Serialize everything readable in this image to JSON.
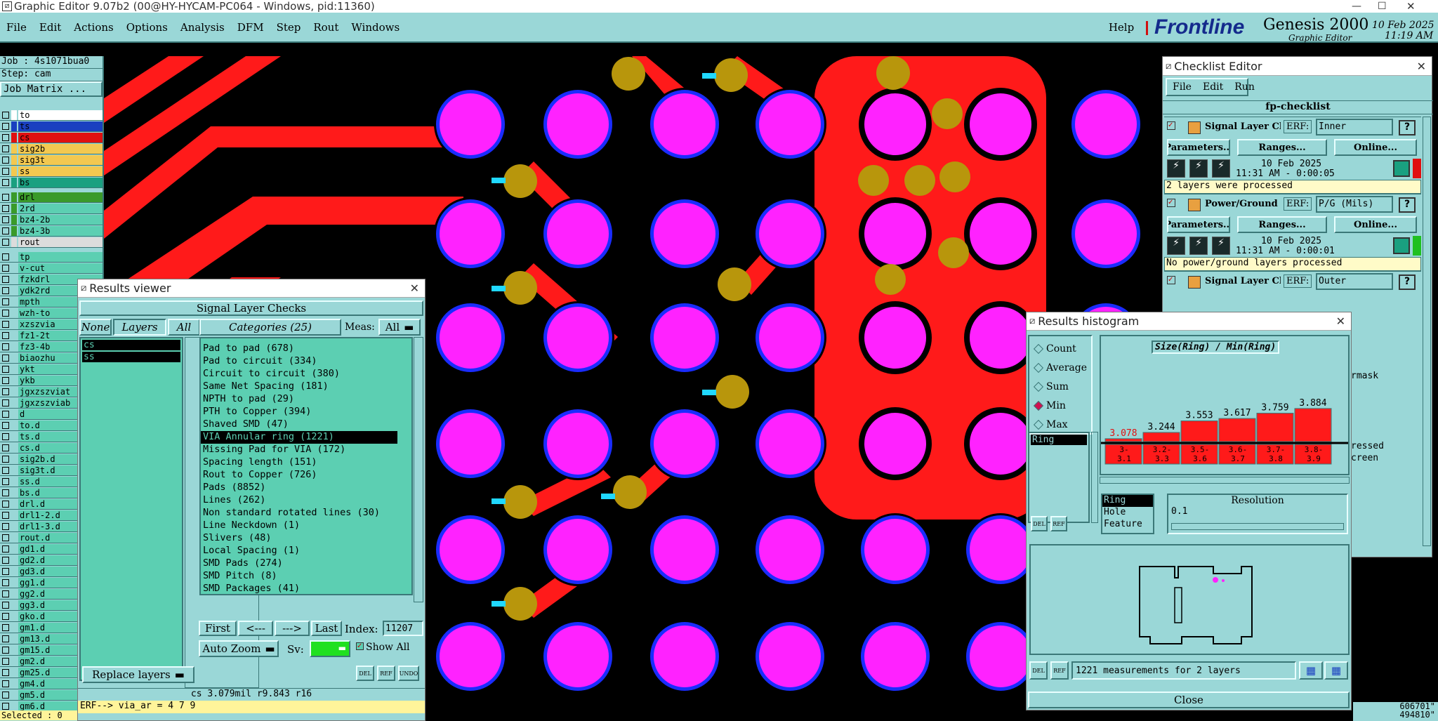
{
  "window": {
    "title": "Graphic Editor 9.07b2 (00@HY-HYCAM-PC064 - Windows, pid:11360)",
    "min": "—",
    "max": "☐",
    "close": "✕"
  },
  "menu": {
    "items": [
      "File",
      "Edit",
      "Actions",
      "Options",
      "Analysis",
      "DFM",
      "Step",
      "Rout",
      "Windows"
    ],
    "help": "Help"
  },
  "brand": {
    "logo": "Frontline",
    "product": "Genesis 2000",
    "subtitle": "Graphic Editor",
    "date": "10 Feb 2025",
    "time": "11:19 AM"
  },
  "left": {
    "job": "Job : 4s1071bua0",
    "step": "Step: cam",
    "matrix_button": "Job Matrix ...",
    "layers_a": [
      "to",
      "ts",
      "cs",
      "sig2b",
      "sig3t",
      "ss",
      "bs"
    ],
    "layers_b": [
      "drl",
      "2rd",
      "bz4-2b",
      "bz4-3b",
      "rout"
    ],
    "layers_c": [
      "tp",
      "v-cut",
      "fzkdrl",
      "ydk2rd",
      "mpth",
      "wzh-to",
      "xzszvia",
      "fz1-2t",
      "fz3-4b",
      "biaozhu",
      "ykt",
      "ykb",
      "jgxzszviat",
      "jgxzszviab",
      "d",
      "to.d",
      "ts.d",
      "cs.d",
      "sig2b.d",
      "sig3t.d",
      "ss.d",
      "bs.d",
      "drl.d",
      "drl1-2.d",
      "drl1-3.d",
      "rout.d",
      "gd1.d",
      "gd2.d",
      "gd3.d",
      "gg1.d",
      "gg2.d",
      "gg3.d",
      "gko.d",
      "gm1.d",
      "gm13.d",
      "gm15.d",
      "gm2.d",
      "gm25.d",
      "gm4.d",
      "gm5.d",
      "gm6.d"
    ],
    "selected": "Selected : 0"
  },
  "results_viewer": {
    "title": "Results viewer",
    "close": "✕",
    "header": "Signal Layer Checks",
    "none": "None",
    "layers": "Layers",
    "all": "All",
    "layer_list": [
      "cs",
      "ss"
    ],
    "categories_button": "Categories (25)",
    "meas_label": "Meas:",
    "meas_value": "All",
    "categories": [
      "Pad to pad (678)",
      "Pad to circuit (334)",
      "Circuit to circuit (380)",
      "Same Net Spacing (181)",
      "NPTH to pad (29)",
      "PTH to Copper (394)",
      "Shaved SMD (47)",
      "VIA Annular ring (1221)",
      "Missing Pad for VIA (172)",
      "Spacing length (151)",
      "Rout to Copper (726)",
      "Pads (8852)",
      "Lines (262)",
      "Non standard rotated lines (30)",
      "Line Neckdown (1)",
      "Slivers (48)",
      "Local Spacing (1)",
      "SMD Pads (274)",
      "SMD Pitch (8)",
      "SMD Packages (41)"
    ],
    "nav": {
      "first": "First",
      "prev": "<---",
      "next": "--->",
      "last": "Last",
      "index_label": "Index:",
      "index_value": "11207"
    },
    "auto_zoom": "Auto Zoom",
    "sv": "Sv:",
    "show_all": "Show All",
    "replace_layers": "Replace layers",
    "del": "DEL",
    "ref": "REF",
    "undo": "UNDO",
    "status": "cs 3.079mil  r9.843  r16",
    "erf": "ERF--> via_ar = 4 7 9"
  },
  "checklist": {
    "title": "Checklist Editor",
    "close": "✕",
    "menu": [
      "File",
      "Edit",
      "Run"
    ],
    "name": "fp-checklist",
    "erf_label": "ERF:",
    "parameters": "Parameters...",
    "ranges": "Ranges...",
    "online": "Online...",
    "help": "?",
    "items": [
      {
        "name": "Signal Layer Ch",
        "erf": "Inner",
        "date": "10 Feb 2025",
        "time": "11:31 AM - 0:00:05",
        "message": "2 layers were processed",
        "status_color": "#e01010"
      },
      {
        "name": "Power/Ground C",
        "erf": "P/G (Mils)",
        "date": "10 Feb 2025",
        "time": "11:31 AM - 0:00:01",
        "message": "No power/ground layers processed",
        "status_color": "#20c020"
      },
      {
        "name": "Signal Layer Ch",
        "erf": "Outer"
      }
    ],
    "partial": [
      "rmask",
      "ressed",
      "creen"
    ]
  },
  "histogram": {
    "title": "Results histogram",
    "close": "✕",
    "modes": [
      "Count",
      "Average",
      "Sum",
      "Min",
      "Max"
    ],
    "selected_mode": "Min",
    "list": [
      "Ring"
    ],
    "chart_title": "Size(Ring) / Min(Ring)",
    "bins": [
      "3-3.1",
      "3.2-3.3",
      "3.5-3.6",
      "3.6-3.7",
      "3.7-3.8",
      "3.8-3.9"
    ],
    "values_text": [
      "3.078",
      "3.244",
      "3.553",
      "3.617",
      "3.759",
      "3.884"
    ],
    "attributes": [
      "Ring",
      "Hole",
      "Feature"
    ],
    "resolution_label": "Resolution",
    "resolution": "0.1",
    "del": "DEL",
    "ref": "REF",
    "summary": "1221 measurements for 2 layers",
    "close_button": "Close"
  },
  "coords": {
    "x": "606701\"",
    "y": "494810\""
  },
  "chart_data": {
    "type": "bar",
    "title": "Size(Ring) / Min(Ring)",
    "categories": [
      "3-3.1",
      "3.2-3.3",
      "3.5-3.6",
      "3.6-3.7",
      "3.7-3.8",
      "3.8-3.9"
    ],
    "values": [
      3.078,
      3.244,
      3.553,
      3.617,
      3.759,
      3.884
    ],
    "xlabel": "",
    "ylabel": ""
  },
  "colors": {
    "panel": "#9ad7d7",
    "list": "#5ccfb2",
    "copper": "#ff1a1a",
    "pad": "#ff22ff",
    "pad_ring": "#1a2cff",
    "via": "#b8960c"
  }
}
